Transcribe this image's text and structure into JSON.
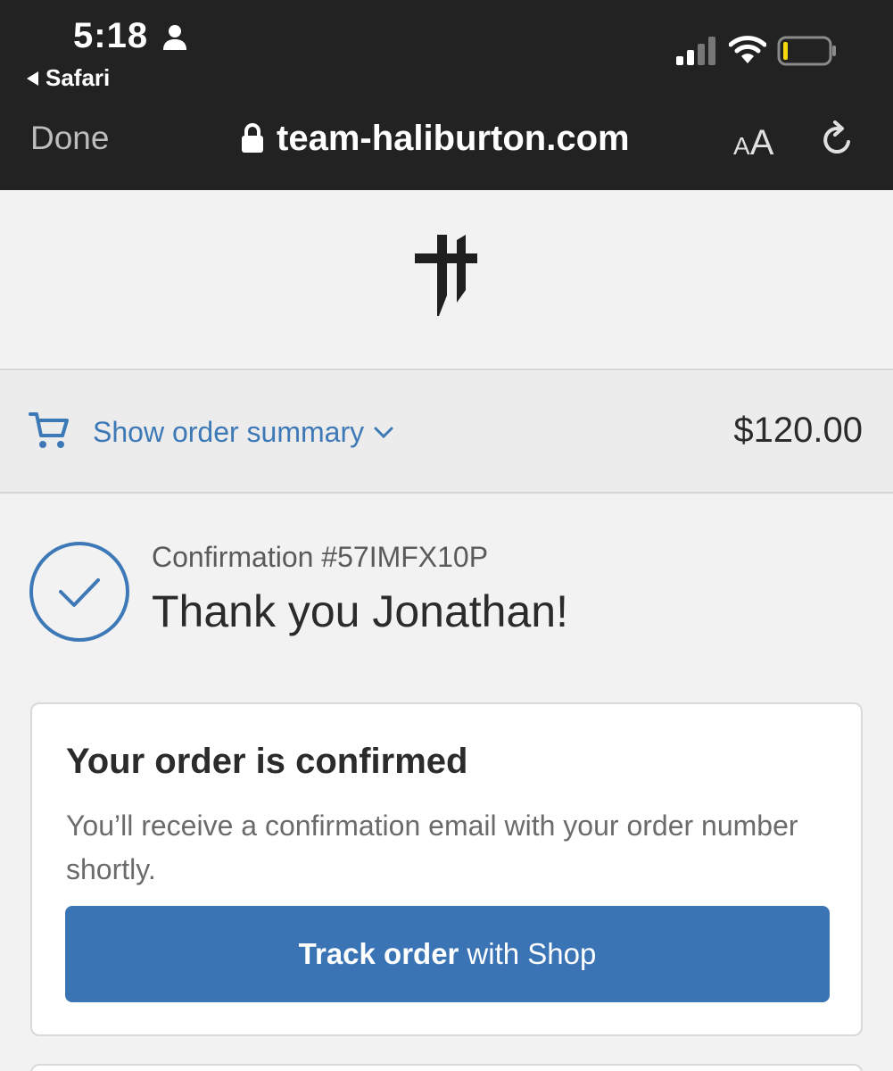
{
  "status_bar": {
    "time": "5:18",
    "back_app": "Safari",
    "battery_color": "#f5d90a"
  },
  "browser": {
    "done_label": "Done",
    "url": "team-haliburton.com",
    "text_size_small": "A",
    "text_size_large": "A"
  },
  "order_summary": {
    "toggle_label": "Show order summary",
    "total": "$120.00"
  },
  "confirmation": {
    "number": "Confirmation #57IMFX10P",
    "thank_you": "Thank you Jonathan!"
  },
  "card": {
    "title": "Your order is confirmed",
    "text": "You’ll receive a confirmation email with your order number shortly.",
    "button_bold": "Track order",
    "button_rest": "with Shop"
  },
  "colors": {
    "accent": "#3a74b5",
    "link": "#3d79b6",
    "topbar": "#222222"
  },
  "icons": [
    "person-icon",
    "back-arrow-icon",
    "signal-icon",
    "wifi-icon",
    "battery-icon",
    "lock-icon",
    "reload-icon",
    "cart-icon",
    "chevron-down-icon",
    "check-circle-icon"
  ]
}
